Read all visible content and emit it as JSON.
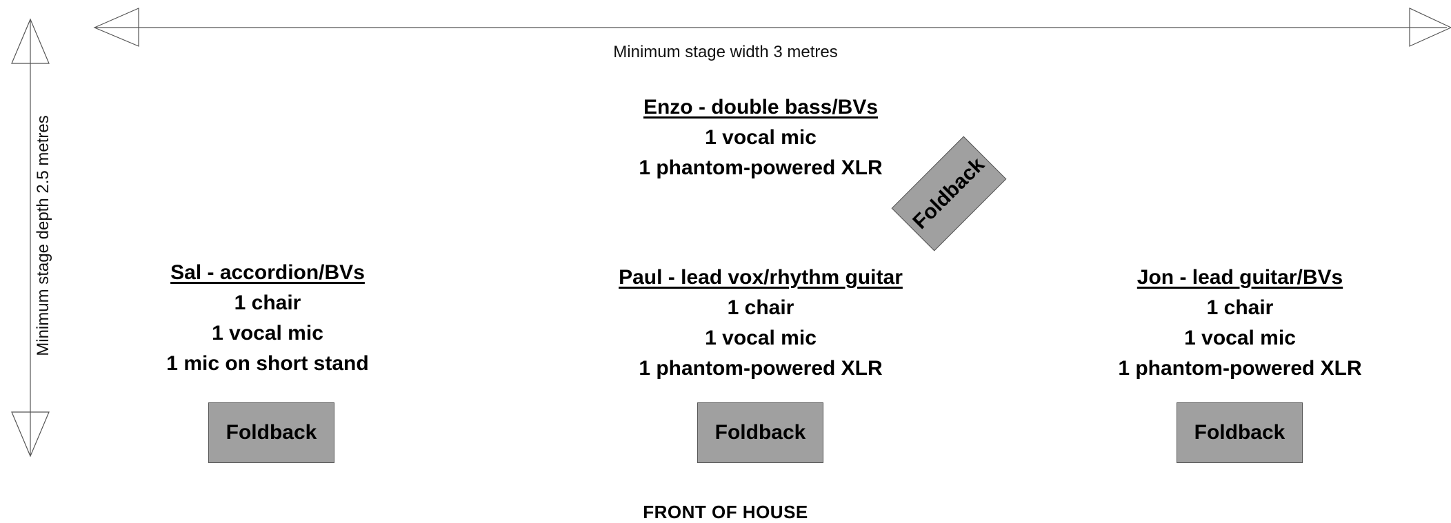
{
  "stage": {
    "width_label": "Minimum stage width 3 metres",
    "depth_label": "Minimum stage depth 2.5 metres",
    "front_label": "FRONT OF HOUSE"
  },
  "musicians": {
    "enzo": {
      "name": "Enzo - double bass/BVs",
      "items": [
        "1 vocal mic",
        "1 phantom-powered XLR"
      ]
    },
    "sal": {
      "name": "Sal - accordion/BVs",
      "items": [
        "1 chair",
        "1 vocal mic",
        "1 mic on short stand"
      ]
    },
    "paul": {
      "name": "Paul - lead vox/rhythm guitar",
      "items": [
        "1 chair",
        "1 vocal mic",
        "1 phantom-powered XLR"
      ]
    },
    "jon": {
      "name": "Jon - lead guitar/BVs",
      "items": [
        "1 chair",
        "1 vocal mic",
        "1 phantom-powered XLR"
      ]
    }
  },
  "foldback_label": "Foldback",
  "colors": {
    "foldback_fill": "#a0a0a0",
    "line": "#555555"
  }
}
